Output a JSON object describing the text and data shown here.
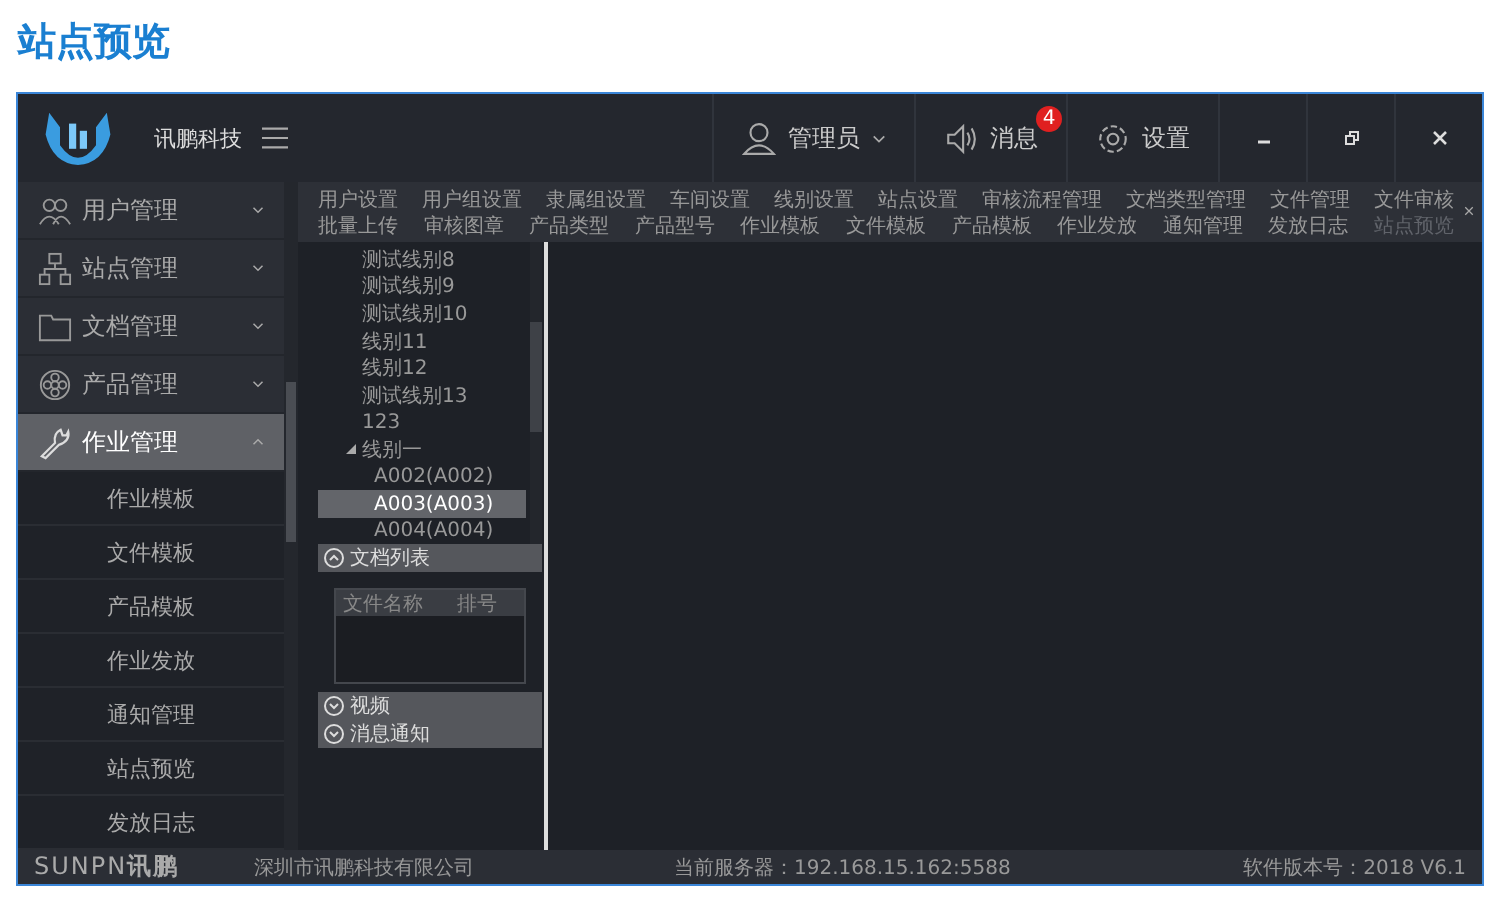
{
  "page_title": "站点预览",
  "header": {
    "brand": "讯鹏科技",
    "user": "管理员",
    "messages": "消息",
    "message_count": "4",
    "settings": "设置"
  },
  "sidebar": {
    "items": [
      {
        "label": "用户管理",
        "expanded": false,
        "selected": false
      },
      {
        "label": "站点管理",
        "expanded": false,
        "selected": false
      },
      {
        "label": "文档管理",
        "expanded": false,
        "selected": false
      },
      {
        "label": "产品管理",
        "expanded": false,
        "selected": false
      },
      {
        "label": "作业管理",
        "expanded": true,
        "selected": true,
        "children": [
          "作业模板",
          "文件模板",
          "产品模板",
          "作业发放",
          "通知管理",
          "站点预览",
          "发放日志"
        ]
      }
    ]
  },
  "tabs": [
    [
      {
        "label": "用户设置",
        "selected": false
      },
      {
        "label": "用户组设置",
        "selected": false
      },
      {
        "label": "隶属组设置",
        "selected": false
      },
      {
        "label": "车间设置",
        "selected": false
      },
      {
        "label": "线别设置",
        "selected": false
      },
      {
        "label": "站点设置",
        "selected": false
      },
      {
        "label": "审核流程管理",
        "selected": false
      },
      {
        "label": "文档类型管理",
        "selected": false
      },
      {
        "label": "文件管理",
        "selected": false
      },
      {
        "label": "文件审核",
        "selected": false
      }
    ],
    [
      {
        "label": "批量上传",
        "selected": false
      },
      {
        "label": "审核图章",
        "selected": false
      },
      {
        "label": "产品类型",
        "selected": false
      },
      {
        "label": "产品型号",
        "selected": false
      },
      {
        "label": "作业模板",
        "selected": false
      },
      {
        "label": "文件模板",
        "selected": false
      },
      {
        "label": "产品模板",
        "selected": false
      },
      {
        "label": "作业发放",
        "selected": false
      },
      {
        "label": "通知管理",
        "selected": false
      },
      {
        "label": "发放日志",
        "selected": false
      },
      {
        "label": "站点预览",
        "selected": true
      }
    ]
  ],
  "tree": [
    {
      "label": "测试线别8",
      "selected": false
    },
    {
      "label": "测试线别9",
      "selected": false
    },
    {
      "label": "测试线别10",
      "selected": false
    },
    {
      "label": "线别11",
      "selected": false
    },
    {
      "label": "线别12",
      "selected": false
    },
    {
      "label": "测试线别13",
      "selected": false
    },
    {
      "label": "123",
      "selected": false
    },
    {
      "label": "线别一",
      "selected": false,
      "expanded": true,
      "children": [
        {
          "label": "A002(A002)",
          "selected": false
        },
        {
          "label": "A003(A003)",
          "selected": true
        },
        {
          "label": "A004(A004)",
          "selected": false
        }
      ]
    }
  ],
  "panels": [
    {
      "title": "文档列表",
      "expanded": true,
      "columns": [
        "文件名称",
        "排号"
      ]
    },
    {
      "title": "视频",
      "expanded": false
    },
    {
      "title": "消息通知",
      "expanded": false
    }
  ],
  "footer": {
    "logo_latin": "SUNPN",
    "logo_cjk": "讯鹏",
    "company": "深圳市讯鹏科技有限公司",
    "server": "当前服务器：192.168.15.162:5588",
    "version": "软件版本号：2018 V6.1"
  }
}
